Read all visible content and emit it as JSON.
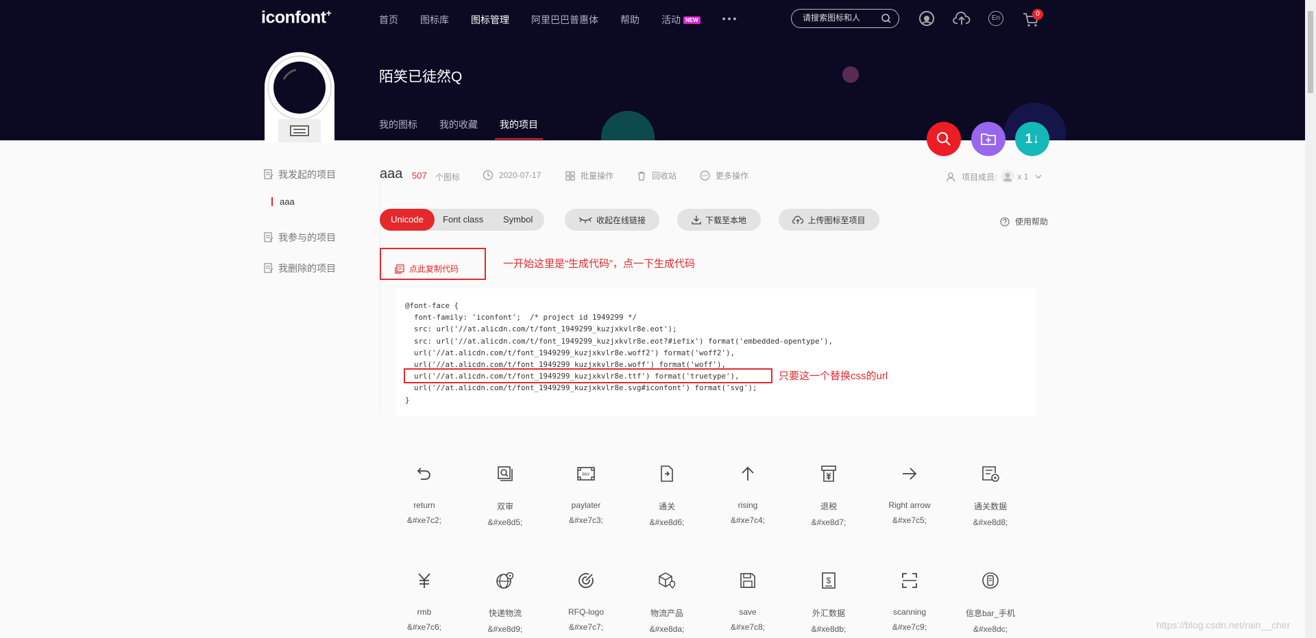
{
  "brand": {
    "logo_text": "iconfont",
    "logo_mark": "+"
  },
  "nav": {
    "items": [
      {
        "label": "首页"
      },
      {
        "label": "图标库"
      },
      {
        "label": "图标管理"
      },
      {
        "label": "阿里巴巴普惠体"
      },
      {
        "label": "帮助"
      },
      {
        "label": "活动"
      }
    ],
    "new_badge": "NEW",
    "more": "•••",
    "search_placeholder": "请搜索图标和人",
    "lang_label": "En",
    "cart_count": "0"
  },
  "profile": {
    "username": "陌笑已徒然Q",
    "tabs": [
      {
        "label": "我的图标"
      },
      {
        "label": "我的收藏"
      },
      {
        "label": "我的项目"
      }
    ]
  },
  "fab": {
    "up_down_label": "1↓"
  },
  "sidebar": {
    "started": "我发起的项目",
    "project": "aaa",
    "joined": "我参与的项目",
    "deleted": "我删除的项目"
  },
  "project": {
    "name": "aaa",
    "count": "507",
    "count_label": "个图标",
    "date": "2020-07-17",
    "batch": "批量操作",
    "recycle": "回收站",
    "more": "更多操作",
    "members_label": "项目成员:",
    "members_count": "x 1"
  },
  "toolbar": {
    "segments": [
      {
        "label": "Unicode"
      },
      {
        "label": "Font class"
      },
      {
        "label": "Symbol"
      }
    ],
    "collapse": "收起在线链接",
    "download": "下载至本地",
    "upload": "上传图标至项目",
    "help": "使用帮助"
  },
  "code": {
    "copy_label": "点此复制代码",
    "lines": [
      "@font-face {",
      "  font-family: 'iconfont';  /* project id 1949299 */",
      "  src: url('//at.alicdn.com/t/font_1949299_kuzjxkvlr8e.eot');",
      "  src: url('//at.alicdn.com/t/font_1949299_kuzjxkvlr8e.eot?#iefix') format('embedded-opentype'),",
      "  url('//at.alicdn.com/t/font_1949299_kuzjxkvlr8e.woff2') format('woff2'),",
      "  url('//at.alicdn.com/t/font_1949299_kuzjxkvlr8e.woff') format('woff'),",
      "  url('//at.alicdn.com/t/font_1949299_kuzjxkvlr8e.ttf') format('truetype'),",
      "  url('//at.alicdn.com/t/font_1949299_kuzjxkvlr8e.svg#iconfont') format('svg');",
      "}"
    ]
  },
  "annotations": {
    "note1": "一开始这里是“生成代码”，点一下生成代码",
    "note2": "只要这一个替换css的url"
  },
  "icons": [
    {
      "name": "return",
      "code": "&#xe7c2;",
      "icon": "return-icon"
    },
    {
      "name": "双审",
      "code": "&#xe8d5;",
      "icon": "double-review-icon"
    },
    {
      "name": "paylater",
      "code": "&#xe7c3;",
      "icon": "paylater-icon"
    },
    {
      "name": "通关",
      "code": "&#xe8d6;",
      "icon": "customs-clearance-icon"
    },
    {
      "name": "rising",
      "code": "&#xe7c4;",
      "icon": "rising-arrow-icon"
    },
    {
      "name": "退税",
      "code": "&#xe8d7;",
      "icon": "tax-refund-icon"
    },
    {
      "name": "Right arrow",
      "code": "&#xe7c5;",
      "icon": "right-arrow-icon"
    },
    {
      "name": "通关数据",
      "code": "&#xe8d8;",
      "icon": "customs-data-icon"
    },
    {
      "name": "rmb",
      "code": "&#xe7c6;",
      "icon": "rmb-icon"
    },
    {
      "name": "快递物流",
      "code": "&#xe8d9;",
      "icon": "express-logistics-icon"
    },
    {
      "name": "RFQ-logo",
      "code": "&#xe7c7;",
      "icon": "rfq-logo-icon"
    },
    {
      "name": "物流产品",
      "code": "&#xe8da;",
      "icon": "logistics-product-icon"
    },
    {
      "name": "save",
      "code": "&#xe7c8;",
      "icon": "save-icon"
    },
    {
      "name": "外汇数据",
      "code": "&#xe8db;",
      "icon": "forex-data-icon"
    },
    {
      "name": "scanning",
      "code": "&#xe7c9;",
      "icon": "scanning-icon"
    },
    {
      "name": "信息bar_手机",
      "code": "&#xe8dc;",
      "icon": "mobile-info-icon"
    }
  ],
  "watermark": "https://blog.csdn.net/rain__cher",
  "colors": {
    "hero_bg": "#0c0923",
    "accent_red": "#e5282b",
    "fab_purple": "#9966ee",
    "fab_teal": "#14b8b8"
  }
}
